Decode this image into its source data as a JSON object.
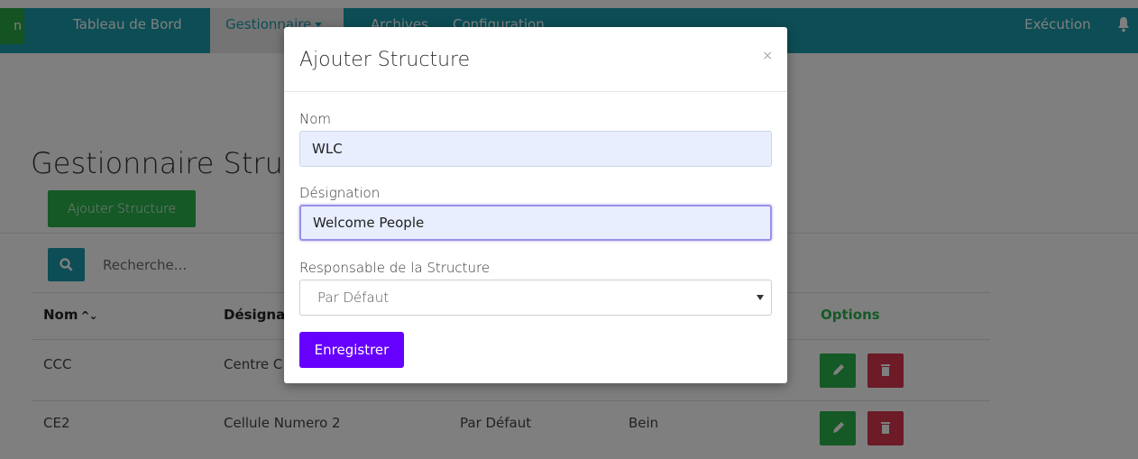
{
  "navbar": {
    "brand_fragment": "n",
    "items": [
      {
        "label": "Tableau de Bord"
      },
      {
        "label": "Gestionnaire"
      },
      {
        "label": "Archives"
      },
      {
        "label": "Configuration"
      }
    ],
    "right_item": "Exécution",
    "bell_icon": "bell-icon"
  },
  "page": {
    "title": "Gestionnaire Structures",
    "add_button": "Ajouter Structure",
    "search": {
      "placeholder": "Recherche..."
    },
    "table": {
      "headers": [
        "Nom",
        "Désignation",
        "Options"
      ],
      "rows": [
        {
          "nom": "CCC",
          "designation": "Centre C",
          "responsable": "",
          "extra": ""
        },
        {
          "nom": "CE2",
          "designation": "Cellule Numero 2",
          "responsable": "Par Défaut",
          "extra": "Bein"
        }
      ]
    }
  },
  "modal": {
    "title": "Ajouter Structure",
    "close": "×",
    "fields": {
      "nom_label": "Nom",
      "nom_value": "WLC",
      "designation_label": "Désignation",
      "designation_value": "Welcome People",
      "responsable_label": "Responsable de la Structure",
      "responsable_value": "Par Défaut"
    },
    "save_button": "Enregistrer"
  },
  "colors": {
    "navbar": "#1b9aaa",
    "success": "#2bb24c",
    "danger": "#d9364f",
    "primary": "#6600ff"
  }
}
